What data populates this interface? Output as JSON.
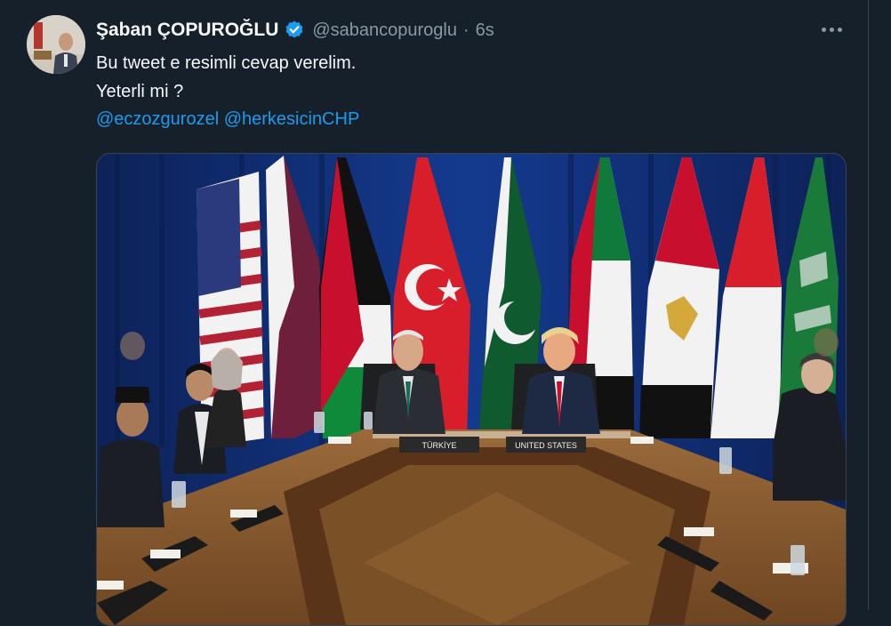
{
  "tweet": {
    "author_name": "Şaban ÇOPUROĞLU",
    "handle": "@sabancopuroglu",
    "separator": "·",
    "time": "6s",
    "text_line_1": "Bu tweet e resimli cevap verelim.",
    "text_line_2": "Yeterli mi ?",
    "mentions": [
      "@eczozgurozel",
      "@herkesicinCHP"
    ]
  },
  "photo": {
    "placard_turkiye": "TÜRKİYE",
    "placard_usa": "UNITED STATES"
  },
  "colors": {
    "background": "#15202b",
    "link": "#1d9bf0",
    "secondary_text": "#8b98a5",
    "verified_badge": "#1d9bf0"
  },
  "icons": {
    "verified": "verified-badge-icon",
    "more": "more-options-icon"
  }
}
